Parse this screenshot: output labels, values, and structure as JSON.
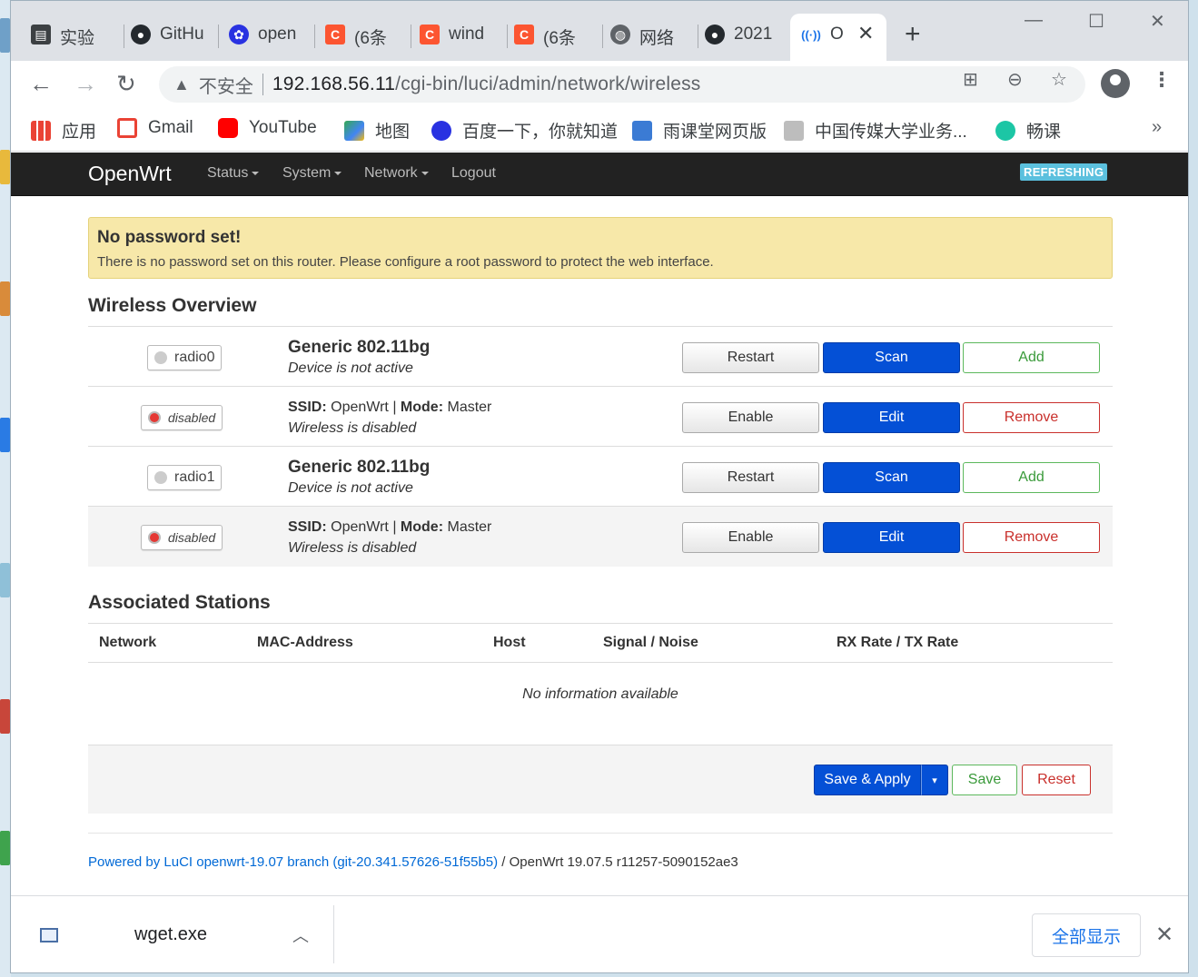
{
  "browser": {
    "tabs": [
      {
        "label": "实验",
        "icon": "book-icon",
        "color": "#3c4043"
      },
      {
        "label": "GitHu",
        "icon": "github-icon",
        "color": "#24292e"
      },
      {
        "label": "open",
        "icon": "baidu-paw-icon",
        "color": "#2932e1"
      },
      {
        "label": "(6条",
        "icon": "csdn-icon",
        "color": "#fc5531"
      },
      {
        "label": "wind",
        "icon": "csdn-icon",
        "color": "#fc5531"
      },
      {
        "label": "(6条",
        "icon": "csdn-icon",
        "color": "#fc5531"
      },
      {
        "label": "网络",
        "icon": "globe-icon",
        "color": "#5f6368"
      },
      {
        "label": "2021",
        "icon": "github-icon",
        "color": "#24292e"
      },
      {
        "label": "O",
        "icon": "wireless-icon",
        "color": "#1a73e8"
      }
    ],
    "new_tab": "+",
    "address": {
      "warning": "不安全",
      "host": "192.168.56.11",
      "path": "/cgi-bin/luci/admin/network/wireless"
    },
    "bookmarks": [
      {
        "label": "应用",
        "icon": "apps-grid-icon"
      },
      {
        "label": "Gmail",
        "icon": "gmail-icon"
      },
      {
        "label": "YouTube",
        "icon": "youtube-icon"
      },
      {
        "label": "地图",
        "icon": "maps-icon"
      },
      {
        "label": "百度一下，你就知道",
        "icon": "baidu-paw-icon"
      },
      {
        "label": "雨课堂网页版",
        "icon": "rain-classroom-icon"
      },
      {
        "label": "中国传媒大学业务...",
        "icon": "home-icon"
      },
      {
        "label": "畅课",
        "icon": "tronclass-icon"
      }
    ],
    "bookmarks_more": "»"
  },
  "luci": {
    "brand": "OpenWrt",
    "menu": [
      "Status",
      "System",
      "Network",
      "Logout"
    ],
    "indicator": "REFRESHING",
    "alert": {
      "title": "No password set!",
      "text": "There is no password set on this router. Please configure a root password to protect the web interface."
    },
    "wireless_title": "Wireless Overview",
    "radios": [
      {
        "name": "radio0",
        "device": "Generic 802.11bg",
        "device_status": "Device is not active",
        "buttons": [
          "Restart",
          "Scan",
          "Add"
        ],
        "iface": {
          "badge": "disabled",
          "ssid_label": "SSID:",
          "ssid": "OpenWrt",
          "sep": "|",
          "mode_label": "Mode:",
          "mode": "Master",
          "status": "Wireless is disabled",
          "buttons": [
            "Enable",
            "Edit",
            "Remove"
          ]
        }
      },
      {
        "name": "radio1",
        "device": "Generic 802.11bg",
        "device_status": "Device is not active",
        "buttons": [
          "Restart",
          "Scan",
          "Add"
        ],
        "iface": {
          "badge": "disabled",
          "ssid_label": "SSID:",
          "ssid": "OpenWrt",
          "sep": "|",
          "mode_label": "Mode:",
          "mode": "Master",
          "status": "Wireless is disabled",
          "buttons": [
            "Enable",
            "Edit",
            "Remove"
          ]
        }
      }
    ],
    "stations": {
      "title": "Associated Stations",
      "columns": [
        "Network",
        "MAC-Address",
        "Host",
        "Signal / Noise",
        "RX Rate / TX Rate"
      ],
      "empty": "No information available"
    },
    "actions": {
      "save_apply": "Save & Apply",
      "dropdown": "▾",
      "save": "Save",
      "reset": "Reset"
    },
    "footer": {
      "link": "Powered by LuCI openwrt-19.07 branch (git-20.341.57626-51f55b5)",
      "rest": " / OpenWrt 19.07.5 r11257-5090152ae3"
    }
  },
  "download": {
    "file": "wget.exe",
    "show_all": "全部显示"
  }
}
